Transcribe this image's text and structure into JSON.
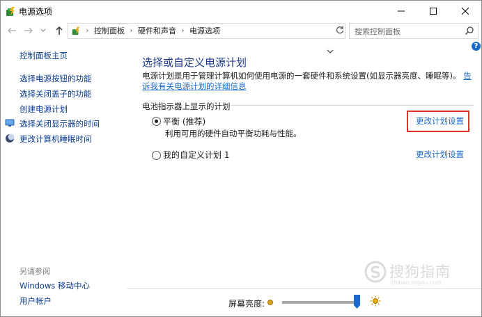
{
  "window": {
    "title": "电源选项"
  },
  "address": {
    "crumbs": [
      "控制面板",
      "硬件和声音",
      "电源选项"
    ],
    "search_placeholder": "搜索控制面板"
  },
  "help": {
    "label": "?"
  },
  "sidebar": {
    "home": "控制面板主页",
    "links": [
      "选择电源按钮的功能",
      "选择关闭盖子的功能",
      "创建电源计划",
      "选择关闭显示器的时间",
      "更改计算机睡眠时间"
    ],
    "see_also_heading": "另请参阅",
    "see_also": [
      "Windows 移动中心",
      "用户帐户"
    ]
  },
  "main": {
    "heading": "选择或自定义电源计划",
    "description": "电源计划是用于管理计算机如何使用电源的一套硬件和系统设置(如显示器亮度、睡眠等)。",
    "description_link": "告诉我有关电源计划的详细信息",
    "group_label": "电池指示器上显示的计划",
    "plans": [
      {
        "name": "平衡 (推荐)",
        "subtitle": "利用可用的硬件自动平衡功耗与性能。",
        "selected": true,
        "change_label": "更改计划设置"
      },
      {
        "name": "我的自定义计划 1",
        "selected": false,
        "change_label": "更改计划设置"
      }
    ]
  },
  "brightness": {
    "label": "屏幕亮度:",
    "value_fraction": 0.97
  },
  "watermark": {
    "text": "搜狗指南",
    "url": "zhinan.sogou.com"
  },
  "colors": {
    "link": "#1b6ac9",
    "heading": "#1e3a8a",
    "highlight": "#d9342b"
  }
}
